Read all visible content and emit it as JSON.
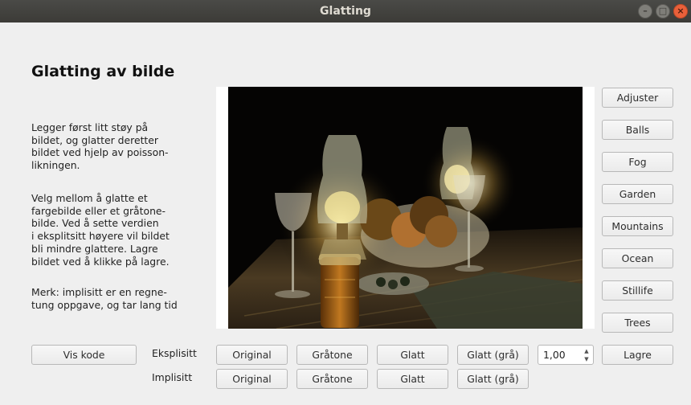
{
  "window": {
    "title": "Glatting",
    "controls": {
      "minimize": "–",
      "maximize": "□",
      "close": "×"
    }
  },
  "main": {
    "heading": "Glatting av bilde",
    "paragraph1": [
      "Legger først litt støy på",
      "bildet, og glatter deretter",
      "bildet ved hjelp av poisson-",
      "likningen."
    ],
    "paragraph2": [
      "Velg mellom å glatte et",
      "fargebilde eller et gråtone-",
      "bilde. Ved å sette verdien",
      "i eksplitsitt høyere vil bildet",
      "bli mindre glattere. Lagre",
      "bildet ved å klikke på lagre."
    ],
    "paragraph3": [
      "Merk: implisitt er en regne-",
      "tung oppgave, og tar lang tid"
    ]
  },
  "image_buttons": [
    "Adjuster",
    "Balls",
    "Fog",
    "Garden",
    "Mountains",
    "Ocean",
    "Stillife",
    "Trees"
  ],
  "bottom": {
    "vis_kode": "Vis kode",
    "eksplisitt_label": "Eksplisitt",
    "implisitt_label": "Implisitt",
    "original": "Original",
    "gratone": "Gråtone",
    "glatt": "Glatt",
    "glatt_gra": "Glatt (grå)",
    "spin_value": "1,00",
    "lagre": "Lagre"
  },
  "photo": {
    "description_icon": "still-life-candle-photo"
  }
}
